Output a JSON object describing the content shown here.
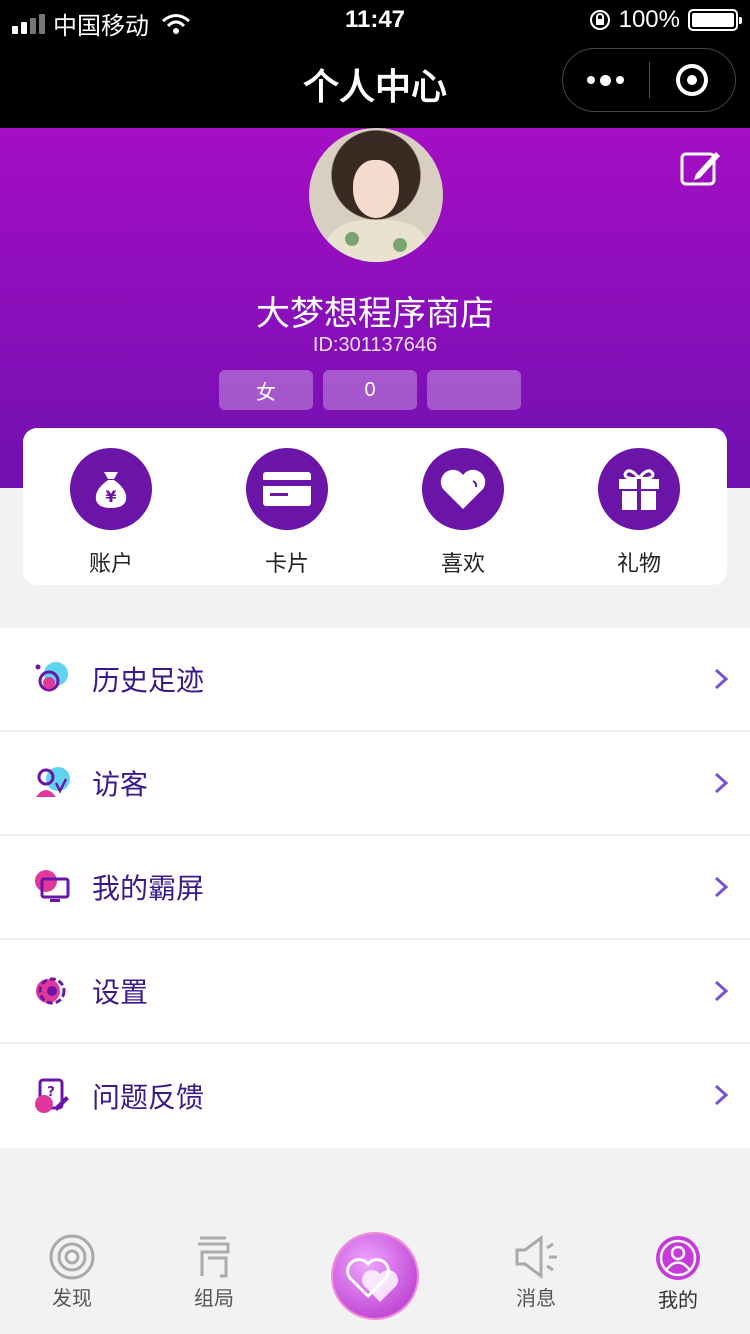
{
  "status_bar": {
    "carrier": "中国移动",
    "time": "11:47",
    "battery": "100%"
  },
  "nav": {
    "title": "个人中心"
  },
  "profile": {
    "name": "大梦想程序商店",
    "id_text": "ID:301137646",
    "tags": [
      "女",
      "0",
      ""
    ]
  },
  "quick_actions": [
    {
      "label": "账户",
      "icon": "money-bag-icon"
    },
    {
      "label": "卡片",
      "icon": "card-icon"
    },
    {
      "label": "喜欢",
      "icon": "heart-icon"
    },
    {
      "label": "礼物",
      "icon": "gift-icon"
    }
  ],
  "menu": [
    {
      "label": "历史足迹",
      "icon": "history-icon"
    },
    {
      "label": "访客",
      "icon": "visitor-icon"
    },
    {
      "label": "我的霸屏",
      "icon": "screen-icon"
    },
    {
      "label": "设置",
      "icon": "settings-gear-icon"
    },
    {
      "label": "问题反馈",
      "icon": "feedback-icon"
    }
  ],
  "tabbar": [
    {
      "label": "发现",
      "icon": "discover-icon"
    },
    {
      "label": "组局",
      "icon": "group-icon"
    },
    {
      "label": "",
      "icon": "hearts-center-icon"
    },
    {
      "label": "消息",
      "icon": "megaphone-icon"
    },
    {
      "label": "我的",
      "icon": "profile-icon"
    }
  ],
  "colors": {
    "header_top": "#a50ec4",
    "header_bottom": "#7010b0",
    "icon_purple": "#6a14a8",
    "menu_text": "#3a1a8a",
    "accent_pink": "#e0389a"
  }
}
